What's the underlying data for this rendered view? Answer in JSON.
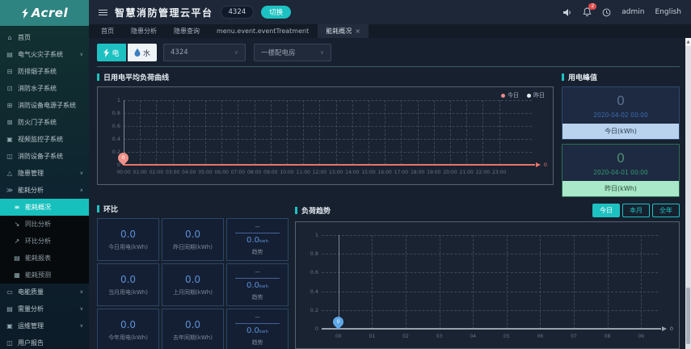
{
  "header": {
    "title": "智慧消防管理云平台",
    "project_badge": "4324",
    "switch_button": "切换",
    "notification_count": "2",
    "username": "admin",
    "language": "English"
  },
  "tabs": [
    {
      "label": "首页",
      "active": false,
      "closable": false
    },
    {
      "label": "隐患分析",
      "active": false,
      "closable": false
    },
    {
      "label": "隐患查询",
      "active": false,
      "closable": false
    },
    {
      "label": "menu.event.eventTreatment",
      "active": false,
      "closable": false
    },
    {
      "label": "能耗概况",
      "active": true,
      "closable": true
    }
  ],
  "sidebar": {
    "logo_text": "Acrel",
    "items": [
      {
        "label": "首页",
        "icon": "home-icon",
        "glyph": "⌂"
      },
      {
        "label": "电气火灾子系统",
        "icon": "electrical-fire-icon",
        "glyph": "▤",
        "chevron": "down"
      },
      {
        "label": "防排烟子系统",
        "icon": "smoke-exhaust-icon",
        "glyph": "⊟"
      },
      {
        "label": "消防水子系统",
        "icon": "fire-water-icon",
        "glyph": "⊡"
      },
      {
        "label": "消防设备电源子系统",
        "icon": "equipment-power-icon",
        "glyph": "⊞"
      },
      {
        "label": "防火门子系统",
        "icon": "fire-door-icon",
        "glyph": "⊠"
      },
      {
        "label": "视频监控子系统",
        "icon": "video-monitor-icon",
        "glyph": "▣"
      },
      {
        "label": "消防设备子系统",
        "icon": "fire-equipment-icon",
        "glyph": "◫"
      },
      {
        "label": "隐患管理",
        "icon": "hazard-management-icon",
        "glyph": "△",
        "chevron": "down"
      },
      {
        "label": "能耗分析",
        "icon": "energy-analysis-icon",
        "glyph": "≫",
        "chevron": "up"
      }
    ],
    "submenu": [
      {
        "label": "能耗概况",
        "icon": "energy-overview-icon",
        "glyph": "≡",
        "active": true
      },
      {
        "label": "同比分析",
        "icon": "yoy-analysis-icon",
        "glyph": "↘",
        "active": false
      },
      {
        "label": "环比分析",
        "icon": "mom-analysis-icon",
        "glyph": "↗",
        "active": false
      },
      {
        "label": "能耗报表",
        "icon": "energy-report-icon",
        "glyph": "▤",
        "active": false
      },
      {
        "label": "能耗预测",
        "icon": "energy-forecast-icon",
        "glyph": "▦",
        "active": false
      }
    ],
    "items_bottom": [
      {
        "label": "电能质量",
        "icon": "power-quality-icon",
        "glyph": "▭",
        "chevron": "down"
      },
      {
        "label": "需量分析",
        "icon": "demand-analysis-icon",
        "glyph": "▤",
        "chevron": "down"
      },
      {
        "label": "运维管理",
        "icon": "ops-management-icon",
        "glyph": "▣",
        "chevron": "down"
      },
      {
        "label": "用户报告",
        "icon": "user-report-icon",
        "glyph": "◫"
      }
    ]
  },
  "filters": {
    "electric_label": "电",
    "water_label": "水",
    "device_select": "4324",
    "room_select": "一楼配电房"
  },
  "daily_load": {
    "title": "日用电平均负荷曲线",
    "legend_today": "今日",
    "legend_yesterday": "昨日",
    "axis_end_label": "0",
    "pin_value": "0"
  },
  "peak": {
    "title": "用电峰值",
    "cards": [
      {
        "value": "0",
        "time": "2020-04-02 00:00",
        "footer": "今日(kWh)"
      },
      {
        "value": "0",
        "time": "2020-04-01 00:00",
        "footer": "昨日(kWh)"
      }
    ]
  },
  "ring": {
    "title": "环比",
    "rows": [
      [
        {
          "value": "0.0",
          "label": "今日用电(kWh)"
        },
        {
          "value": "0.0",
          "label": "昨日同期(kWh)"
        },
        {
          "trend_top": "--",
          "trend_value": "0.0",
          "trend_unit": "kwh",
          "label": "趋势"
        }
      ],
      [
        {
          "value": "0.0",
          "label": "当月用电(kWh)"
        },
        {
          "value": "0.0",
          "label": "上月同期(kWh)"
        },
        {
          "trend_top": "--",
          "trend_value": "0.0",
          "trend_unit": "kwh",
          "label": "趋势"
        }
      ],
      [
        {
          "value": "0.0",
          "label": "今年用电(kWh)"
        },
        {
          "value": "0.0",
          "label": "去年同期(kWh)"
        },
        {
          "trend_top": "--",
          "trend_value": "0.0",
          "trend_unit": "kwh",
          "label": "趋势"
        }
      ]
    ]
  },
  "load_trend": {
    "title": "负荷趋势",
    "buttons": [
      {
        "label": "今日",
        "active": true
      },
      {
        "label": "本月",
        "active": false
      },
      {
        "label": "全年",
        "active": false
      }
    ],
    "axis_end_label": "0",
    "pin_value": "0"
  },
  "chart_data": [
    {
      "type": "line",
      "title": "日用电平均负荷曲线",
      "x": [
        "00:00",
        "01:00",
        "02:00",
        "03:00",
        "04:00",
        "05:00",
        "06:00",
        "07:00",
        "08:00",
        "09:00",
        "10:00",
        "11:00",
        "12:00",
        "13:00",
        "14:00",
        "15:00",
        "16:00",
        "17:00",
        "18:00",
        "19:00",
        "20:00",
        "21:00",
        "22:00",
        "23:00"
      ],
      "y_ticks": [
        "1",
        "0.8",
        "0.6",
        "0.4",
        "0.2",
        "0"
      ],
      "ylim": [
        0,
        1
      ],
      "series": [
        {
          "name": "今日",
          "values": [
            0,
            0,
            0,
            0,
            0,
            0,
            0,
            0,
            0,
            0,
            0,
            0,
            0,
            0,
            0,
            0,
            0,
            0,
            0,
            0,
            0,
            0,
            0,
            0
          ]
        },
        {
          "name": "昨日",
          "values": [
            0,
            0,
            0,
            0,
            0,
            0,
            0,
            0,
            0,
            0,
            0,
            0,
            0,
            0,
            0,
            0,
            0,
            0,
            0,
            0,
            0,
            0,
            0,
            0
          ]
        }
      ],
      "legend_position": "top-right",
      "grid": "dashed"
    },
    {
      "type": "line",
      "title": "负荷趋势",
      "x": [
        "00",
        "01",
        "02",
        "03",
        "04",
        "05",
        "06",
        "07",
        "08",
        "09"
      ],
      "y_ticks": [
        "1",
        "0.8",
        "0.6",
        "0.4",
        "0.2",
        "0"
      ],
      "ylim": [
        0,
        1
      ],
      "series": [
        {
          "name": "今日",
          "values": [
            0,
            0,
            0,
            0,
            0,
            0,
            0,
            0,
            0,
            0
          ]
        }
      ],
      "legend_position": "none",
      "grid": "dashed"
    }
  ],
  "colors": {
    "accent_teal": "#1ec1c1",
    "today_red": "#e98c8c",
    "yesterday_white": "#e8edf2",
    "pin_salmon": "#f0918a",
    "pin_blue": "#5fa8e8",
    "zero_line_red": "#e87568",
    "zero_line_gray": "#98a0ac",
    "peak_today_footer": "#b9d3ee",
    "peak_yesterday_footer": "#a9e8c8",
    "value_blue": "#5b8fd4",
    "alert_red": "#e34d4d"
  }
}
